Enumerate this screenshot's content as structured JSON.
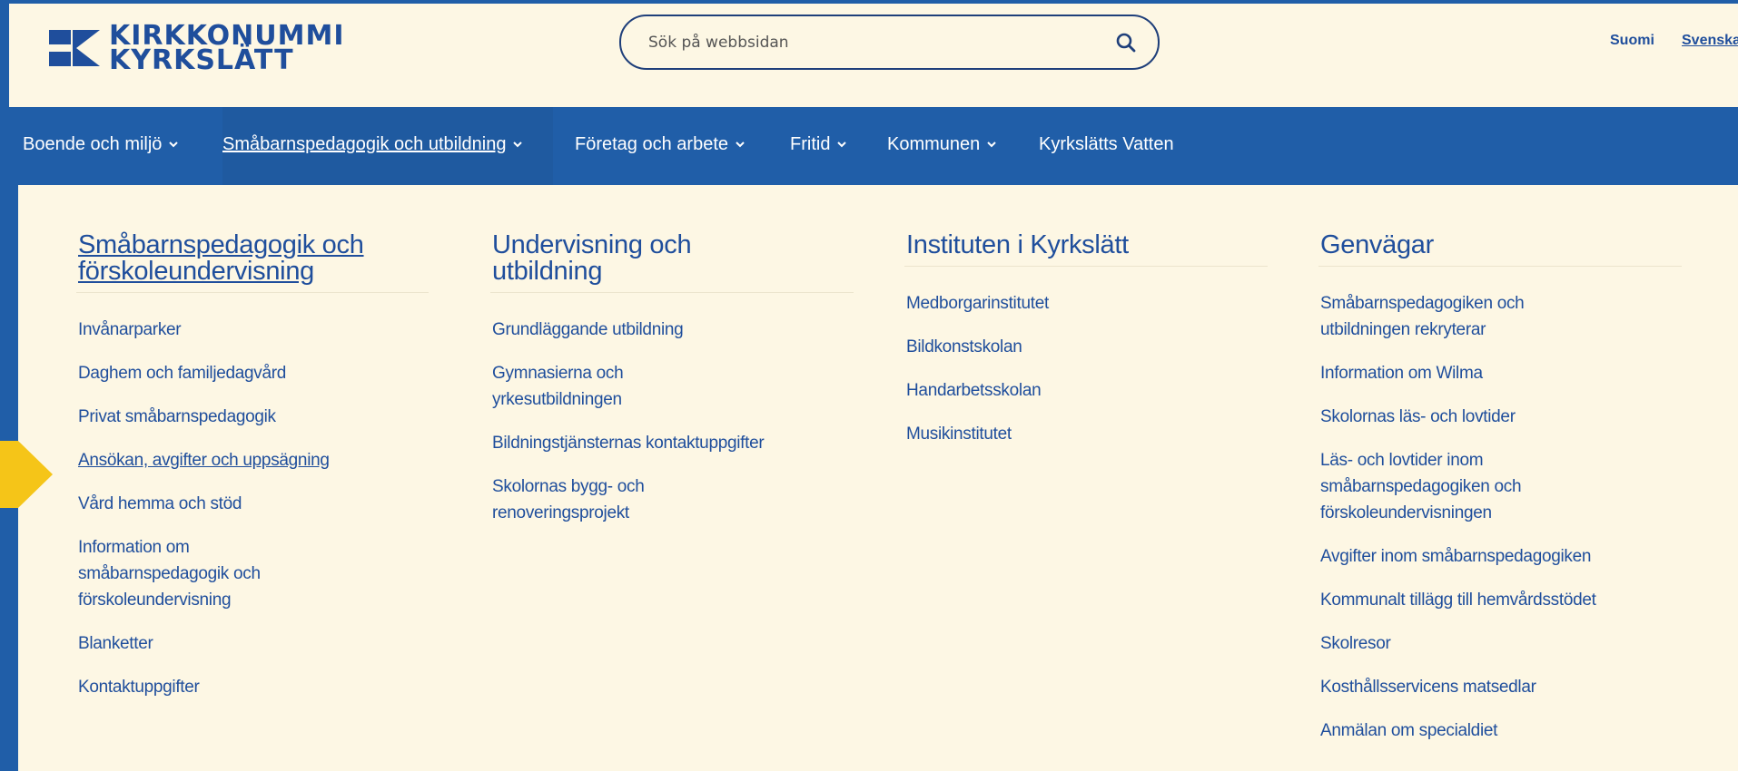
{
  "header": {
    "logo": {
      "line1": "KIRKKONUMMI",
      "line2": "KYRKSLÄTT",
      "mark_color": "#1f4e9c"
    },
    "search": {
      "placeholder": "Sök på webbsidan",
      "value": ""
    },
    "languages": [
      {
        "label": "Suomi",
        "active": false
      },
      {
        "label": "Svenska",
        "active": true
      }
    ]
  },
  "nav": {
    "items": [
      {
        "label": "Boende och miljö",
        "has_dropdown": true,
        "active": false
      },
      {
        "label": "Småbarnspedagogik och utbildning",
        "has_dropdown": true,
        "active": true
      },
      {
        "label": "Företag och arbete",
        "has_dropdown": true,
        "active": false
      },
      {
        "label": "Fritid",
        "has_dropdown": true,
        "active": false
      },
      {
        "label": "Kommunen",
        "has_dropdown": true,
        "active": false
      },
      {
        "label": "Kyrkslätts Vatten",
        "has_dropdown": false,
        "active": false
      }
    ]
  },
  "dropdown": {
    "columns": [
      {
        "heading": "Småbarnspedagogik och förskoleundervisning",
        "heading_line1": "Småbarnspedagogik och",
        "heading_line2": "förskoleundervisning",
        "links": [
          "Invånarparker",
          "Daghem och familjedagvård",
          "Privat småbarnspedagogik",
          "Ansökan, avgifter och uppsägning",
          "Vård hemma och stöd",
          "Information om småbarnspedagogik och förskoleundervisning",
          "Blanketter",
          "Kontaktuppgifter"
        ]
      },
      {
        "heading": "Undervisning och utbildning",
        "heading_line1": "Undervisning och",
        "heading_line2": "utbildning",
        "links": [
          "Grundläggande utbildning",
          "Gymnasierna och yrkesutbildningen",
          "Bildningstjänsternas kontaktuppgifter",
          "Skolornas bygg- och renoveringsprojekt"
        ]
      },
      {
        "heading": "Instituten i Kyrkslätt",
        "links": [
          "Medborgarinstitutet",
          "Bildkonstskolan",
          "Handarbetsskolan",
          "Musikinstitutet"
        ]
      },
      {
        "heading": "Genvägar",
        "links": [
          "Småbarnspedagogiken och utbildningen rekryterar",
          "Information om Wilma",
          "Skolornas läs- och lovtider",
          "Läs- och lovtider inom småbarnspedagogiken och förskoleundervisningen",
          "Avgifter inom småbarnspedagogiken",
          "Kommunalt tillägg till hemvårdsstödet",
          "Skolresor",
          "Kosthållsservicens matsedlar",
          "Anmälan om specialdiet"
        ]
      }
    ]
  },
  "colors": {
    "brand_blue": "#205ea8",
    "link_blue": "#1f4e9c",
    "background": "#fdf7e4",
    "highlight_arrow": "#f5c518"
  },
  "icons": {
    "search": "search-icon",
    "chevron": "chevron-down-icon",
    "arrow": "arrow-right-icon"
  }
}
